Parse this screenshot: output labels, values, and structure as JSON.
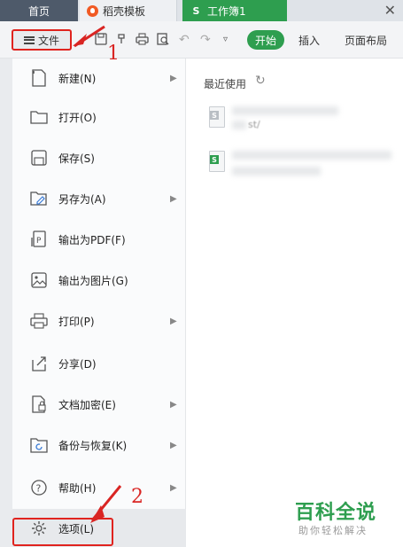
{
  "tabs": {
    "home": "首页",
    "template": "稻壳模板",
    "sheet": "工作簿1",
    "sheet_icon": "S"
  },
  "toolbar": {
    "file_label": "文件",
    "start_label": "开始",
    "insert_label": "插入",
    "layout_label": "页面布局"
  },
  "file_menu": {
    "items": [
      {
        "label": "新建(N)",
        "icon": "new-doc-icon",
        "has_submenu": true
      },
      {
        "label": "打开(O)",
        "icon": "folder-icon",
        "has_submenu": false
      },
      {
        "label": "保存(S)",
        "icon": "save-icon",
        "has_submenu": false
      },
      {
        "label": "另存为(A)",
        "icon": "save-as-icon",
        "has_submenu": true
      },
      {
        "label": "输出为PDF(F)",
        "icon": "pdf-export-icon",
        "has_submenu": false
      },
      {
        "label": "输出为图片(G)",
        "icon": "image-export-icon",
        "has_submenu": false
      },
      {
        "label": "打印(P)",
        "icon": "printer-icon",
        "has_submenu": true
      },
      {
        "label": "分享(D)",
        "icon": "share-icon",
        "has_submenu": false
      },
      {
        "label": "文档加密(E)",
        "icon": "encrypt-icon",
        "has_submenu": true
      },
      {
        "label": "备份与恢复(K)",
        "icon": "backup-icon",
        "has_submenu": true
      },
      {
        "label": "帮助(H)",
        "icon": "help-icon",
        "has_submenu": true
      },
      {
        "label": "选项(L)",
        "icon": "gear-icon",
        "has_submenu": false
      }
    ]
  },
  "recent": {
    "title": "最近使用",
    "files": [
      {
        "path_fragment": "st/"
      },
      {
        "path_fragment": ""
      }
    ]
  },
  "annotations": {
    "step1": "1",
    "step2": "2"
  },
  "watermark": {
    "logo": "百科全说",
    "subtitle": "助你轻松解决"
  },
  "colors": {
    "accent_green": "#2e9e4f",
    "annotation_red": "#e0231e"
  }
}
